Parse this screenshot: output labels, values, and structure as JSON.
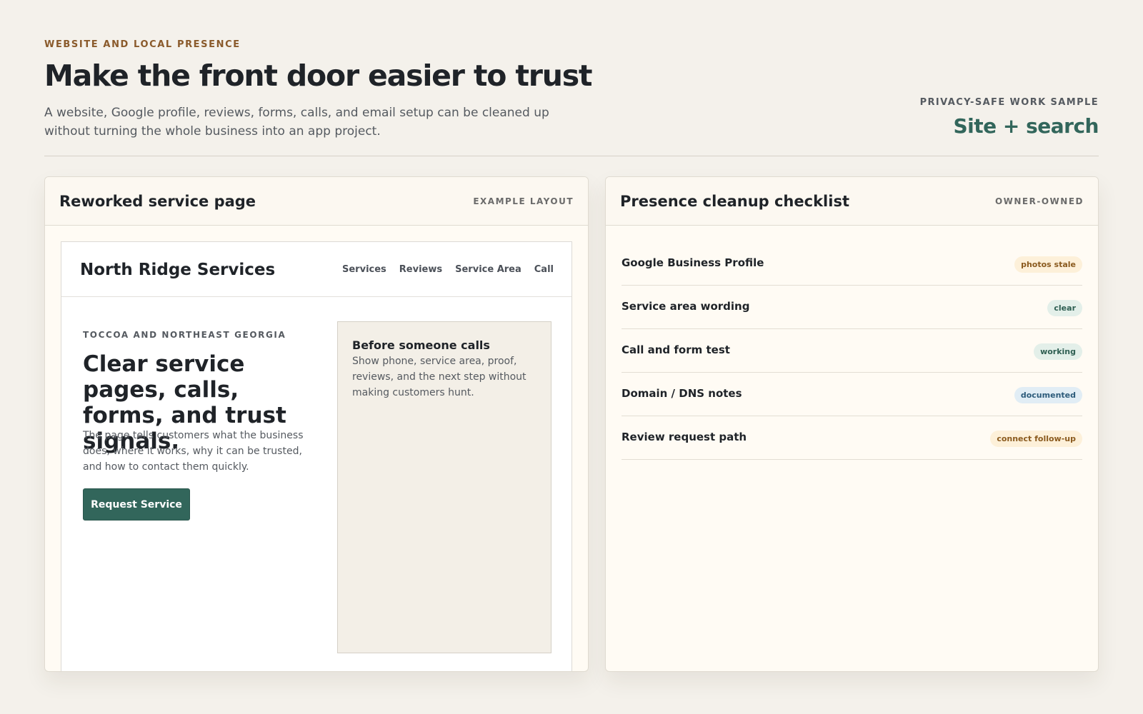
{
  "header": {
    "eyebrow": "WEBSITE AND LOCAL PRESENCE",
    "title": "Make the front door easier to trust",
    "lede": "A website, Google profile, reviews, forms, calls, and email setup can be cleaned up without turning the whole business into an app project.",
    "sample_kicker": "PRIVACY-SAFE WORK SAMPLE",
    "sample_title": "Site + search"
  },
  "left_card": {
    "title": "Reworked service page",
    "tag": "EXAMPLE LAYOUT",
    "mock": {
      "brand": "North Ridge Services",
      "nav": [
        "Services",
        "Reviews",
        "Service Area",
        "Call"
      ],
      "hero_eyebrow": "TOCCOA AND NORTHEAST GEORGIA",
      "hero_title": "Clear service pages, calls, forms, and trust signals.",
      "hero_text": "The page tells customers what the business does, where it works, why it can be trusted, and how to contact them quickly.",
      "cta": "Request Service",
      "aside_title": "Before someone calls",
      "aside_text": "Show phone, service area, proof, reviews, and the next step without making customers hunt."
    }
  },
  "right_card": {
    "title": "Presence cleanup checklist",
    "tag": "OWNER-OWNED",
    "items": [
      {
        "label": "Google Business Profile",
        "status": "photos stale",
        "bg": "#fdf0d9",
        "fg": "#8a5a1e"
      },
      {
        "label": "Service area wording",
        "status": "clear",
        "bg": "#e3efe9",
        "fg": "#2f5f52"
      },
      {
        "label": "Call and form test",
        "status": "working",
        "bg": "#e3efe9",
        "fg": "#2f5f52"
      },
      {
        "label": "Domain / DNS notes",
        "status": "documented",
        "bg": "#e1edf5",
        "fg": "#2c5b7a"
      },
      {
        "label": "Review request path",
        "status": "connect follow-up",
        "bg": "#fdf0d9",
        "fg": "#8a5a1e"
      }
    ]
  }
}
